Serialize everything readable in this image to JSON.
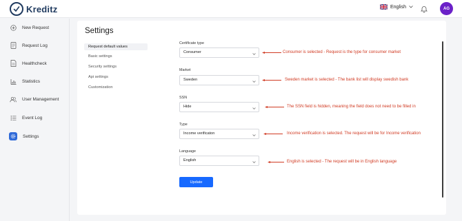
{
  "header": {
    "logo_text": "Kreditz",
    "language": "English",
    "avatar_initials": "AG"
  },
  "sidebar": {
    "items": [
      {
        "label": "New Request",
        "icon": "plus-circle-icon"
      },
      {
        "label": "Request Log",
        "icon": "document-list-icon"
      },
      {
        "label": "Healthcheck",
        "icon": "document-icon"
      },
      {
        "label": "Statistics",
        "icon": "bar-chart-icon"
      },
      {
        "label": "User Management",
        "icon": "users-icon"
      },
      {
        "label": "Event Log",
        "icon": "list-icon"
      },
      {
        "label": "Settings",
        "icon": "gear-icon",
        "active": true
      }
    ]
  },
  "page": {
    "title": "Settings"
  },
  "subnav": {
    "items": [
      {
        "label": "Request default values",
        "active": true
      },
      {
        "label": "Basic settings"
      },
      {
        "label": "Security settings"
      },
      {
        "label": "Api settings"
      },
      {
        "label": "Customization"
      }
    ]
  },
  "form": {
    "fields": [
      {
        "label": "Certificate type",
        "value": "Consumer",
        "note": "Consumer is selected - Request is the type for consumer market"
      },
      {
        "label": "Market",
        "value": "Sweden",
        "note": "Sweden market is selected - The bank list will display swedish bank"
      },
      {
        "label": "SSN",
        "value": "Hide",
        "note": "The SSN field is hidden, meaning the field does not need to be filled in"
      },
      {
        "label": "Type",
        "value": "Income verificaton",
        "note": "Income verification is selected. The request will be for Income verification"
      },
      {
        "label": "Language",
        "value": "English",
        "note": "English is selected - The request will be in English language"
      }
    ],
    "update_label": "Update"
  },
  "colors": {
    "accent": "#1769ff",
    "annotation": "#d03a22",
    "avatar": "#6b21c8",
    "brand": "#1f3a5f"
  }
}
